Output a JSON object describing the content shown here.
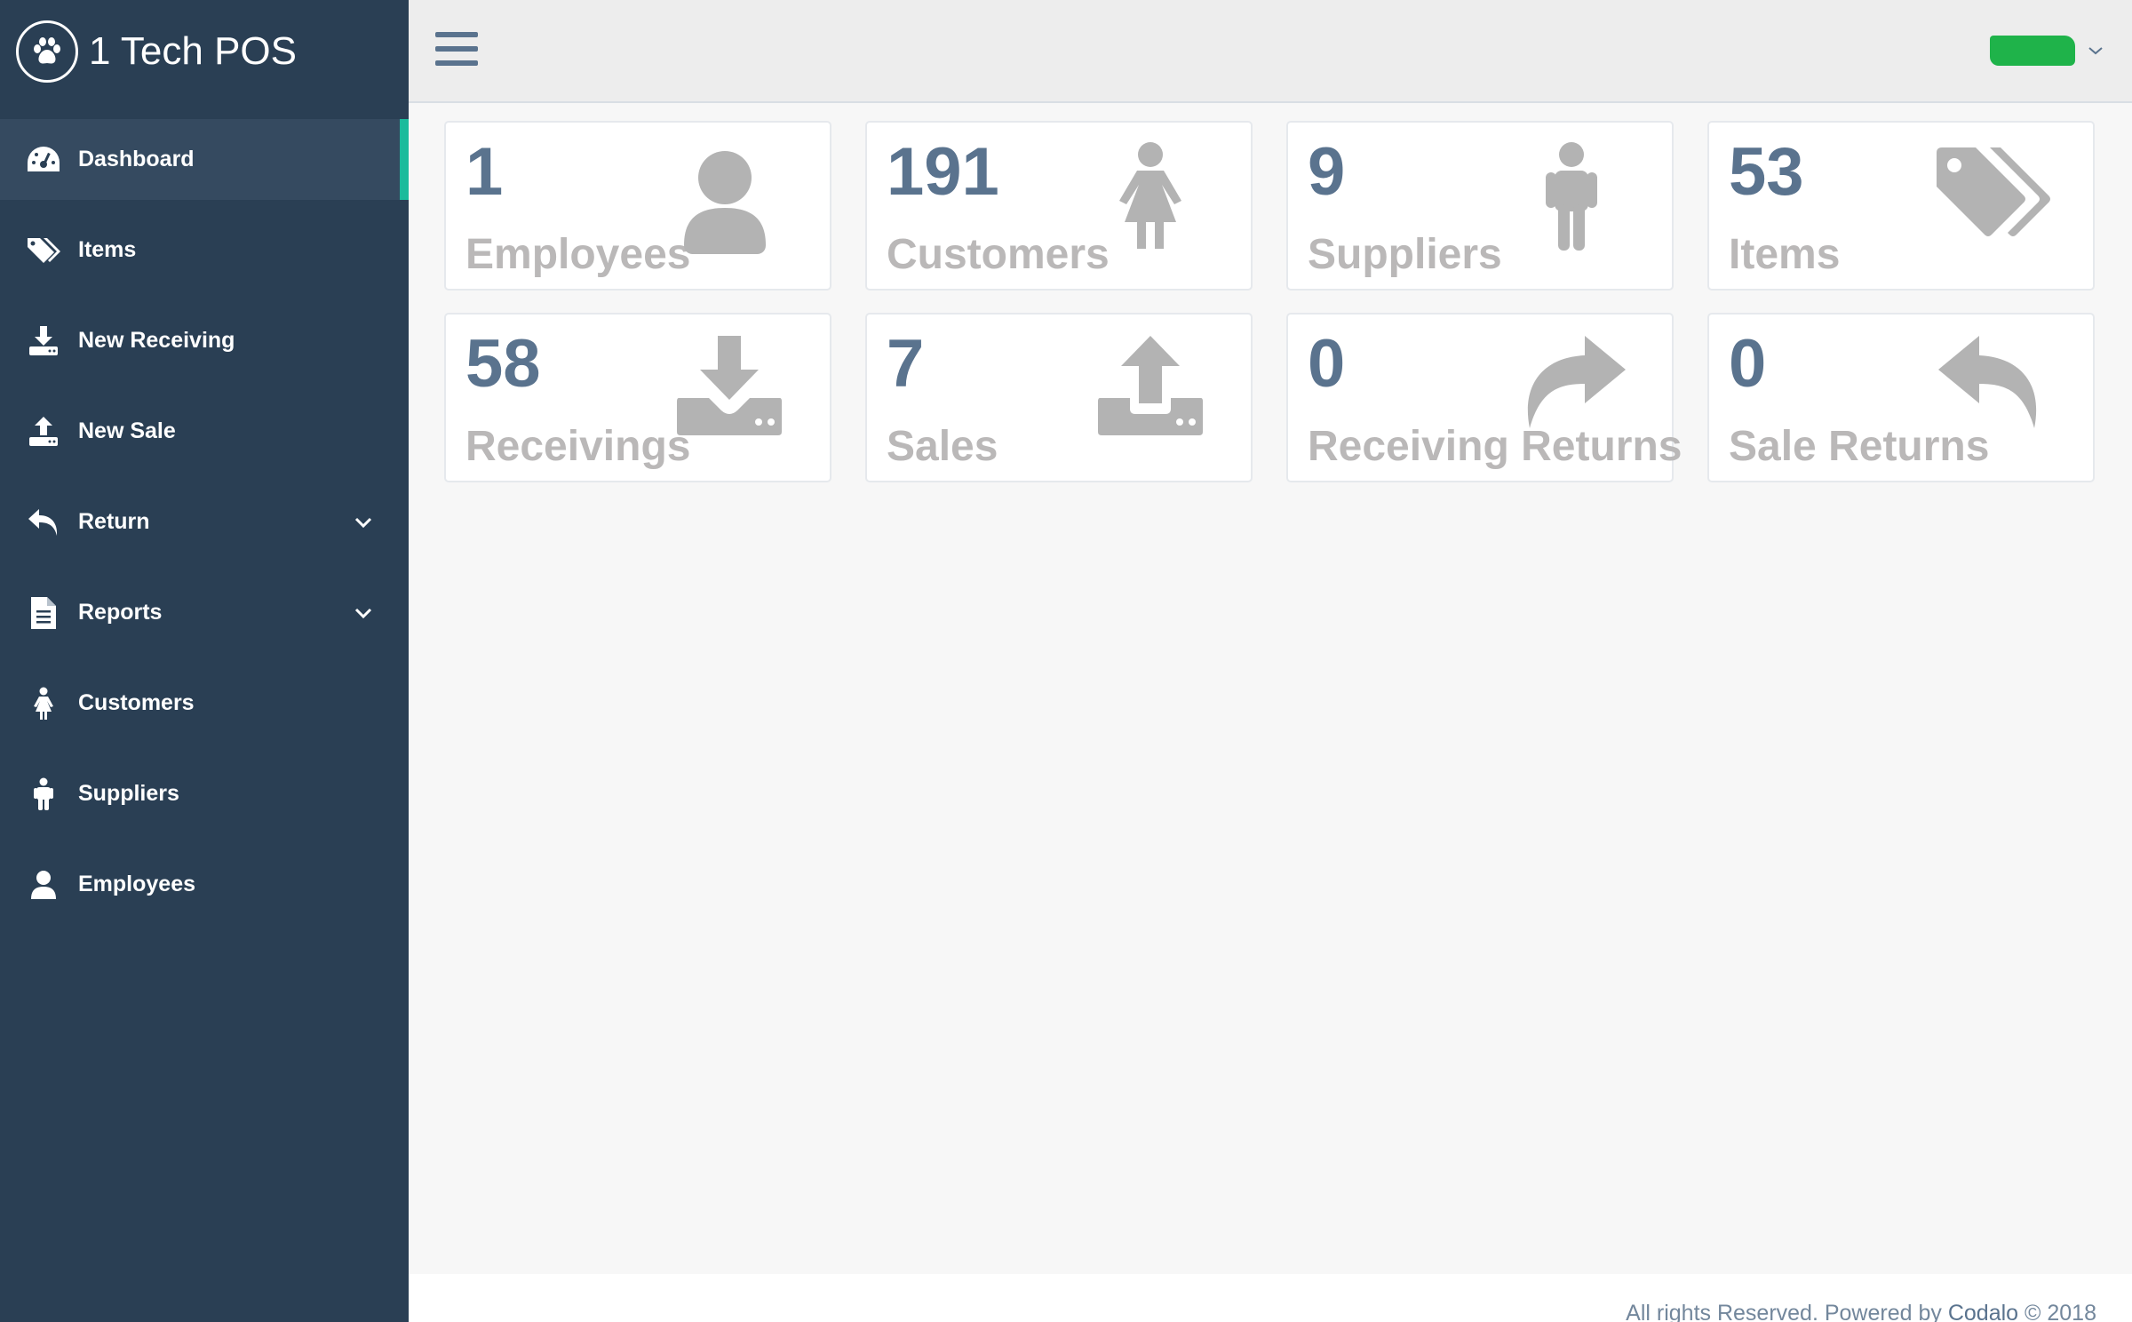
{
  "brand": {
    "title": "1 Tech POS",
    "logo_icon": "paw-icon"
  },
  "sidebar": {
    "items": [
      {
        "label": "Dashboard",
        "icon": "dashboard-icon",
        "active": true
      },
      {
        "label": "Items",
        "icon": "tags-icon"
      },
      {
        "label": "New Receiving",
        "icon": "download-icon"
      },
      {
        "label": "New Sale",
        "icon": "upload-icon"
      },
      {
        "label": "Return",
        "icon": "reply-icon",
        "has_submenu": true
      },
      {
        "label": "Reports",
        "icon": "file-text-icon",
        "has_submenu": true
      },
      {
        "label": "Customers",
        "icon": "female-icon"
      },
      {
        "label": "Suppliers",
        "icon": "male-icon"
      },
      {
        "label": "Employees",
        "icon": "user-icon"
      }
    ],
    "accent_color": "#1abb9c"
  },
  "header": {
    "menu_toggle_icon": "hamburger-icon",
    "user_badge_color": "#1fb34a",
    "user_menu_icon": "chevron-down-icon"
  },
  "tiles": [
    {
      "count": "1",
      "label": "Employees",
      "icon": "user-icon"
    },
    {
      "count": "191",
      "label": "Customers",
      "icon": "female-icon"
    },
    {
      "count": "9",
      "label": "Suppliers",
      "icon": "male-icon"
    },
    {
      "count": "53",
      "label": "Items",
      "icon": "tags-icon"
    },
    {
      "count": "58",
      "label": "Receivings",
      "icon": "download-icon"
    },
    {
      "count": "7",
      "label": "Sales",
      "icon": "upload-icon"
    },
    {
      "count": "0",
      "label": "Receiving Returns",
      "icon": "share-icon"
    },
    {
      "count": "0",
      "label": "Sale Returns",
      "icon": "reply-icon"
    }
  ],
  "footer": {
    "text": "All rights Reserved. Powered by ",
    "link": "Codalo",
    "suffix": " © 2018"
  },
  "colors": {
    "sidebar_bg": "#2a3f54",
    "count_color": "#5a738e",
    "label_color": "#bab8b8",
    "icon_color": "#b3b3b3"
  }
}
